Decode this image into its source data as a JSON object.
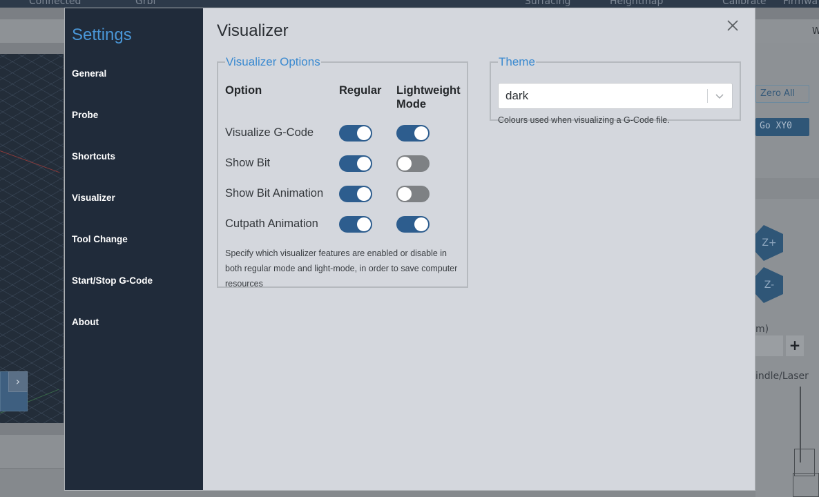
{
  "background": {
    "topbar": {
      "status": "Connected",
      "firmware": "Grbl",
      "tools": [
        "Surfacing",
        "Heightmap",
        "Calibrate",
        "Firmwa"
      ]
    },
    "header_right": "W",
    "right_panel": {
      "zero_all": "Zero All",
      "go_xy0": "Go XY0",
      "z_plus": "Z+",
      "z_minus": "Z-",
      "unit_suffix": "m)",
      "plus": "+",
      "spindle_tab": "indle/Laser"
    }
  },
  "settings": {
    "title": "Settings",
    "nav": [
      "General",
      "Probe",
      "Shortcuts",
      "Visualizer",
      "Tool Change",
      "Start/Stop G-Code",
      "About"
    ]
  },
  "page": {
    "title": "Visualizer",
    "options": {
      "legend": "Visualizer Options",
      "col_option": "Option",
      "col_regular": "Regular",
      "col_lightweight": "Lightweight Mode",
      "rows": [
        {
          "label": "Visualize G-Code",
          "regular": true,
          "lightweight": true
        },
        {
          "label": "Show Bit",
          "regular": true,
          "lightweight": false
        },
        {
          "label": "Show Bit Animation",
          "regular": true,
          "lightweight": false
        },
        {
          "label": "Cutpath Animation",
          "regular": true,
          "lightweight": true
        }
      ],
      "description": "Specify which visualizer features are enabled or disable in both regular mode and light-mode, in order to save computer resources"
    },
    "theme": {
      "legend": "Theme",
      "selected": "dark",
      "help": "Colours used when visualizing a G-Code file."
    }
  }
}
